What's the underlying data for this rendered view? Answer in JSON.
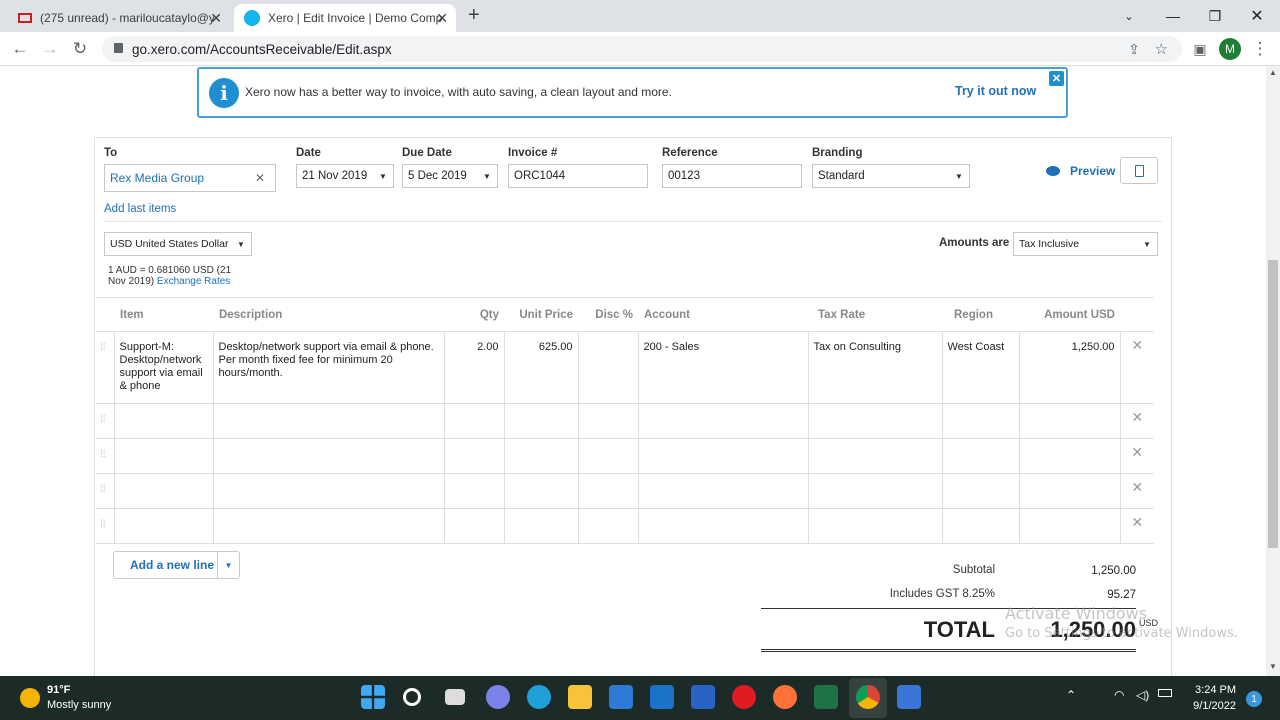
{
  "browser": {
    "tabs": [
      {
        "title": "(275 unread) - mariloucataylo@y",
        "icon": "gmail-icon"
      },
      {
        "title": "Xero | Edit Invoice | Demo Comp",
        "icon": "xero-icon"
      }
    ],
    "url": "go.xero.com/AccountsReceivable/Edit.aspx",
    "profile_initial": "M"
  },
  "banner": {
    "text": "Xero now has a better way to invoice, with auto saving, a clean layout and more.",
    "link": "Try it out now"
  },
  "invoice": {
    "to_label": "To",
    "to_value": "Rex Media Group",
    "date_label": "Date",
    "date_value": "21 Nov 2019",
    "due_label": "Due Date",
    "due_value": "5 Dec 2019",
    "number_label": "Invoice #",
    "number_value": "ORC1044",
    "reference_label": "Reference",
    "reference_value": "00123",
    "branding_label": "Branding",
    "branding_value": "Standard",
    "preview_label": "Preview",
    "add_last_items": "Add last items",
    "currency": "USD United States Dollar",
    "exchange_text": "1 AUD = 0.681060 USD (21 Nov 2019)",
    "exchange_link": "Exchange Rates",
    "amounts_are_label": "Amounts are",
    "amounts_are_value": "Tax Inclusive"
  },
  "table": {
    "headers": [
      "Item",
      "Description",
      "Qty",
      "Unit Price",
      "Disc %",
      "Account",
      "Tax Rate",
      "Region",
      "Amount USD"
    ],
    "rows": [
      {
        "item": "Support-M: Desktop/network support via email & phone",
        "description": "Desktop/network support via email & phone. Per month fixed fee for minimum 20 hours/month.",
        "qty": "2.00",
        "unit_price": "625.00",
        "disc": "",
        "account": "200 - Sales",
        "tax_rate": "Tax on Consulting",
        "region": "West Coast",
        "amount": "1,250.00"
      }
    ]
  },
  "actions": {
    "add_line": "Add a new line"
  },
  "summary": {
    "subtotal_label": "Subtotal",
    "subtotal_value": "1,250.00",
    "gst_label": "Includes GST 8.25%",
    "gst_value": "95.27",
    "total_label": "TOTAL",
    "total_value": "1,250.00",
    "total_currency": "USD"
  },
  "watermark": {
    "line1": "Activate Windows",
    "line2": "Go to Settings to activate Windows."
  },
  "taskbar": {
    "temp": "91°F",
    "weather": "Mostly sunny",
    "time": "3:24 PM",
    "date": "9/1/2022",
    "notification_count": "1"
  }
}
